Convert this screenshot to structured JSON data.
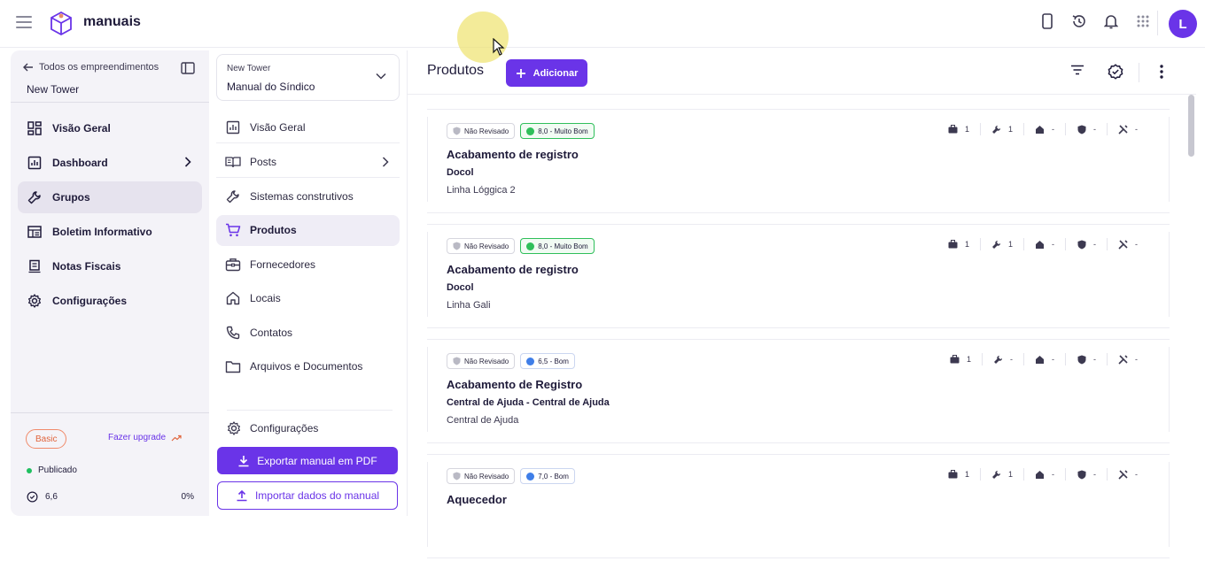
{
  "app": {
    "brand": "manuais",
    "user_initial": "L",
    "accent": "#6a34e8"
  },
  "sidebar": {
    "back_label": "Todos os empreendimentos",
    "project_name": "New Tower",
    "items": [
      {
        "label": "Visão Geral",
        "icon": "grid-icon"
      },
      {
        "label": "Dashboard",
        "icon": "chart-icon",
        "has_chevron": true
      },
      {
        "label": "Grupos",
        "icon": "wrench-icon",
        "active": true
      },
      {
        "label": "Boletim Informativo",
        "icon": "newspaper-icon"
      },
      {
        "label": "Notas Fiscais",
        "icon": "receipt-icon"
      },
      {
        "label": "Configurações",
        "icon": "gear-icon"
      }
    ],
    "plan": "Basic",
    "upgrade_label": "Fazer upgrade",
    "status": "Publicado",
    "score": "6,6",
    "progress": "0%"
  },
  "manual_nav": {
    "project": "New Tower",
    "manual": "Manual do Síndico",
    "items": [
      {
        "label": "Visão Geral",
        "icon": "chart-icon"
      },
      {
        "label": "Posts",
        "icon": "book-icon",
        "has_chevron": true
      },
      {
        "label": "Sistemas construtivos",
        "icon": "wrench-icon"
      },
      {
        "label": "Produtos",
        "icon": "cart-icon",
        "active": true
      },
      {
        "label": "Fornecedores",
        "icon": "briefcase-icon"
      },
      {
        "label": "Locais",
        "icon": "home-icon"
      },
      {
        "label": "Contatos",
        "icon": "phone-icon"
      },
      {
        "label": "Arquivos e Documentos",
        "icon": "folder-icon"
      }
    ],
    "settings_label": "Configurações",
    "export_label": "Exportar manual em PDF",
    "import_label": "Importar dados do manual"
  },
  "main": {
    "title": "Produtos",
    "add_label": "Adicionar",
    "products": [
      {
        "review": "Não Revisado",
        "rating": "8,0 - Muito Bom",
        "rating_color": "green",
        "title": "Acabamento de registro",
        "brand": "Docol",
        "line": "Linha Lóggica 2",
        "stats": [
          "1",
          "1",
          "-",
          "-",
          "-"
        ]
      },
      {
        "review": "Não Revisado",
        "rating": "8,0 - Muito Bom",
        "rating_color": "green",
        "title": "Acabamento de registro",
        "brand": "Docol",
        "line": "Linha Gali",
        "stats": [
          "1",
          "1",
          "-",
          "-",
          "-"
        ]
      },
      {
        "review": "Não Revisado",
        "rating": "6,5 - Bom",
        "rating_color": "blue",
        "title": "Acabamento de Registro",
        "brand": "Central de Ajuda - Central de Ajuda",
        "line": "Central de Ajuda",
        "stats": [
          "1",
          "-",
          "-",
          "-",
          "-"
        ]
      },
      {
        "review": "Não Revisado",
        "rating": "7,0 - Bom",
        "rating_color": "blue",
        "title": "Aquecedor",
        "brand": "",
        "line": "",
        "stats": [
          "1",
          "1",
          "-",
          "-",
          "-"
        ]
      }
    ]
  }
}
